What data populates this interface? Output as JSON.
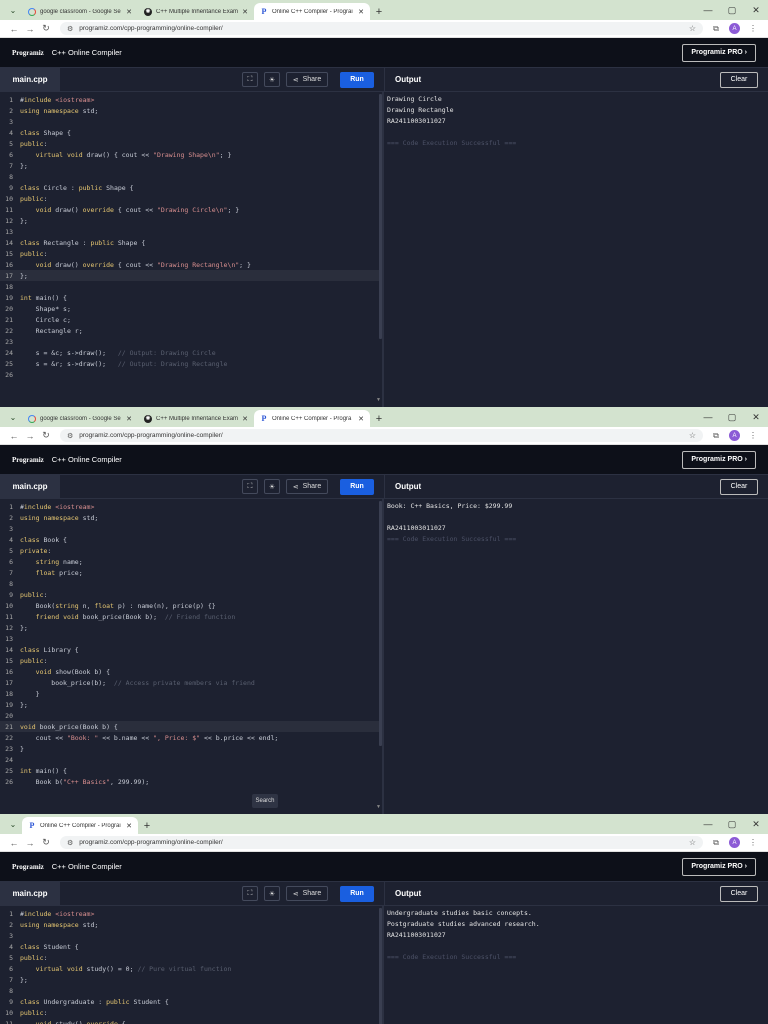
{
  "shots": [
    {
      "tabs": [
        {
          "title": "google classroom - Google Se",
          "icon": "google-icon",
          "active": false
        },
        {
          "title": "C++ Multiple Inheritance Exam",
          "icon": "chatgpt-icon",
          "active": false
        },
        {
          "title": "Online C++ Compiler - Prograi",
          "icon": "programiz-icon",
          "active": true
        }
      ],
      "url": "programiz.com/cpp-programming/online-compiler/",
      "avatar_letter": "A",
      "header": {
        "logo": "Programiz",
        "title": "C++ Online Compiler",
        "pro_button": "Programiz PRO ›"
      },
      "toolbar": {
        "file_tab": "main.cpp",
        "share": "Share",
        "run": "Run",
        "output_title": "Output",
        "clear": "Clear"
      },
      "highlight_line": 17,
      "code": [
        "#include <iostream>",
        "using namespace std;",
        "",
        "class Shape {",
        "public:",
        "    virtual void draw() { cout << \"Drawing Shape\\n\"; }",
        "};",
        "",
        "class Circle : public Shape {",
        "public:",
        "    void draw() override { cout << \"Drawing Circle\\n\"; }",
        "};",
        "",
        "class Rectangle : public Shape {",
        "public:",
        "    void draw() override { cout << \"Drawing Rectangle\\n\"; }",
        "};",
        "",
        "int main() {",
        "    Shape* s;",
        "    Circle c;",
        "    Rectangle r;",
        "",
        "    s = &c; s->draw();   // Output: Drawing Circle",
        "    s = &r; s->draw();   // Output: Drawing Rectangle",
        ""
      ],
      "output": [
        {
          "text": "Drawing Circle",
          "muted": false
        },
        {
          "text": "Drawing Rectangle",
          "muted": false
        },
        {
          "text": "RA2411003011027",
          "muted": false
        },
        {
          "text": "",
          "muted": false
        },
        {
          "text": "=== Code Execution Successful ===",
          "muted": true
        }
      ]
    },
    {
      "tabs": [
        {
          "title": "google classroom - Google Se",
          "icon": "google-icon",
          "active": false
        },
        {
          "title": "C++ Multiple Inheritance Exam",
          "icon": "chatgpt-icon",
          "active": false
        },
        {
          "title": "Online C++ Compiler - Progra",
          "icon": "programiz-icon",
          "active": true
        }
      ],
      "url": "programiz.com/cpp-programming/online-compiler/",
      "avatar_letter": "A",
      "header": {
        "logo": "Programiz",
        "title": "C++ Online Compiler",
        "pro_button": "Programiz PRO ›"
      },
      "toolbar": {
        "file_tab": "main.cpp",
        "share": "Share",
        "run": "Run",
        "output_title": "Output",
        "clear": "Clear"
      },
      "highlight_line": 21,
      "search_label": "Search",
      "code": [
        "#include <iostream>",
        "using namespace std;",
        "",
        "class Book {",
        "private:",
        "    string name;",
        "    float price;",
        "",
        "public:",
        "    Book(string n, float p) : name(n), price(p) {}",
        "    friend void book_price(Book b);  // Friend function",
        "};",
        "",
        "class Library {",
        "public:",
        "    void show(Book b) {",
        "        book_price(b);  // Access private members via friend",
        "    }",
        "};",
        "",
        "void book_price(Book b) {",
        "    cout << \"Book: \" << b.name << \", Price: $\" << b.price << endl;",
        "}",
        "",
        "int main() {",
        "    Book b(\"C++ Basics\", 299.99);"
      ],
      "output": [
        {
          "text": "Book: C++ Basics, Price: $299.99",
          "muted": false
        },
        {
          "text": "",
          "muted": false
        },
        {
          "text": "RA2411003011027",
          "muted": false
        },
        {
          "text": "=== Code Execution Successful ===",
          "muted": true
        }
      ]
    },
    {
      "tabs": [
        {
          "title": "Online C++ Compiler - Prograi",
          "icon": "programiz-icon",
          "active": true
        }
      ],
      "url": "programiz.com/cpp-programming/online-compiler/",
      "avatar_letter": "A",
      "header": {
        "logo": "Programiz",
        "title": "C++ Online Compiler",
        "pro_button": "Programiz PRO ›"
      },
      "toolbar": {
        "file_tab": "main.cpp",
        "share": "Share",
        "run": "Run",
        "output_title": "Output",
        "clear": "Clear"
      },
      "highlight_line": 0,
      "code": [
        "#include <iostream>",
        "using namespace std;",
        "",
        "class Student {",
        "public:",
        "    virtual void study() = 0; // Pure virtual function",
        "};",
        "",
        "class Undergraduate : public Student {",
        "public:",
        "    void study() override {"
      ],
      "output": [
        {
          "text": "Undergraduate studies basic concepts.",
          "muted": false
        },
        {
          "text": "Postgraduate studies advanced research.",
          "muted": false
        },
        {
          "text": "RA2411003011027",
          "muted": false
        },
        {
          "text": "",
          "muted": false
        },
        {
          "text": "=== Code Execution Successful ===",
          "muted": true
        }
      ]
    }
  ],
  "colors": {
    "keyword": "#e8c872",
    "string": "#d98f8f",
    "comment": "#5a6070",
    "text": "#c8ccd6",
    "run": "#1a5fe0"
  }
}
